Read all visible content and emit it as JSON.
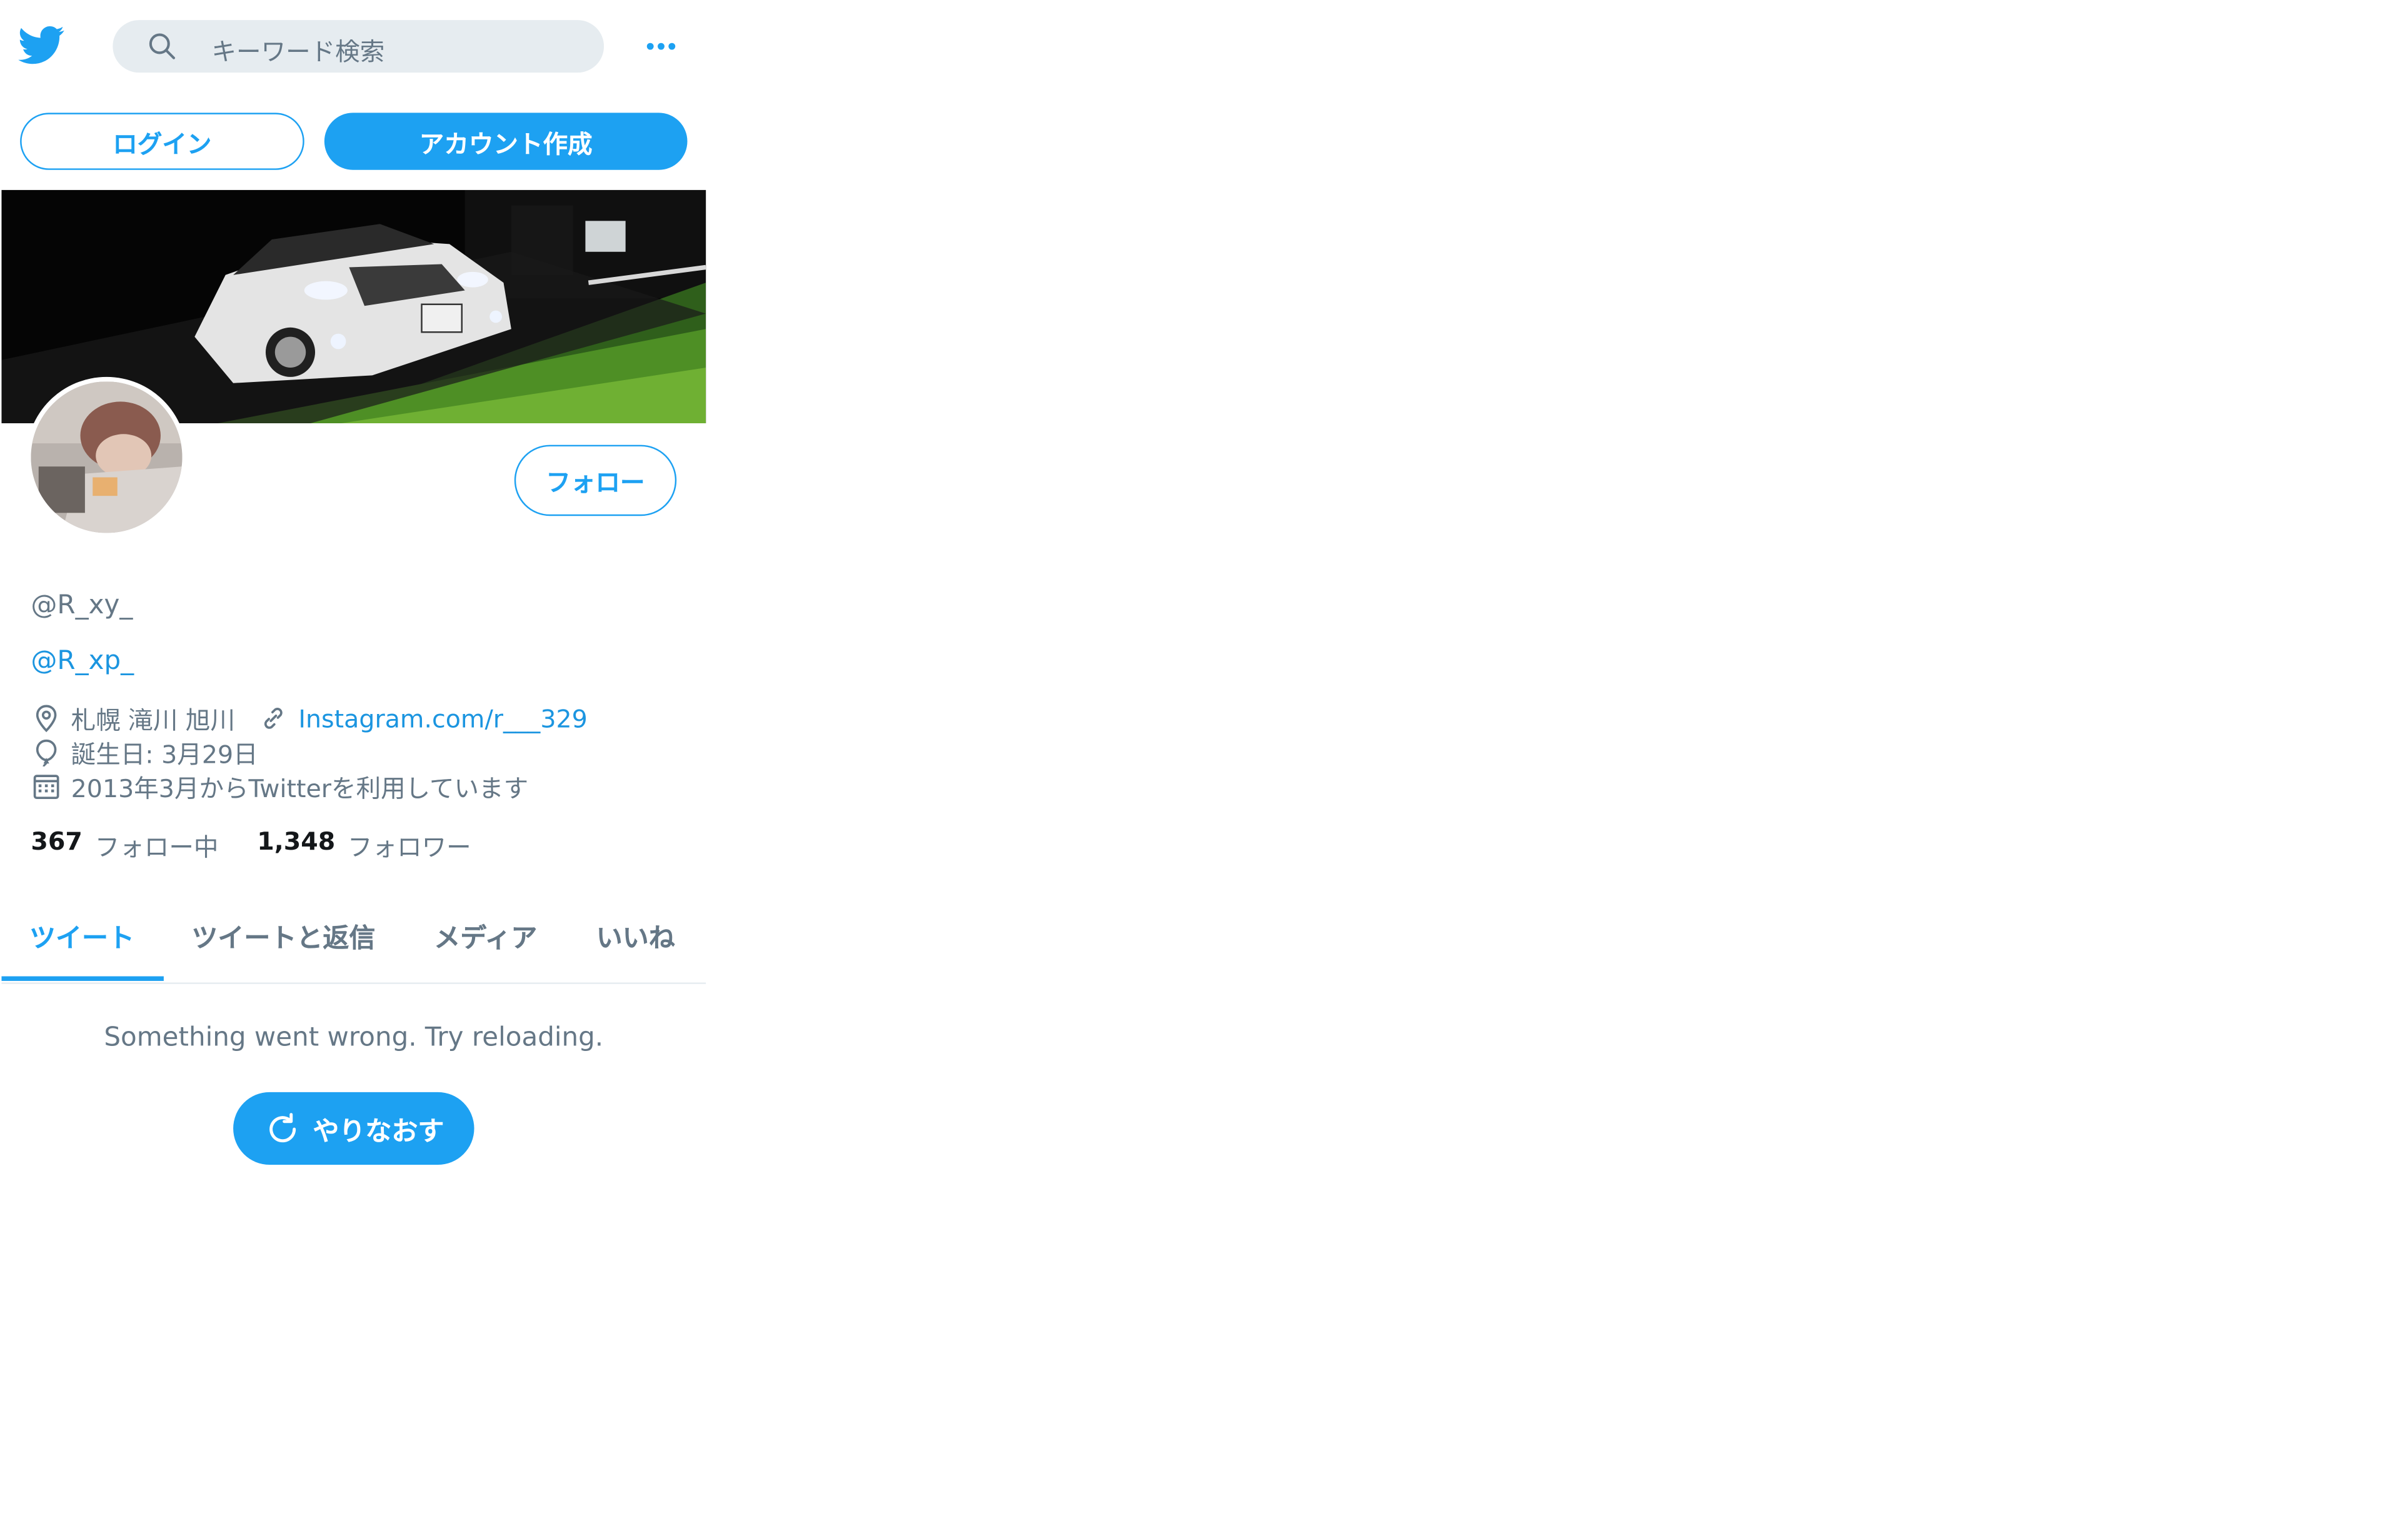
{
  "header": {
    "logo_icon": "twitter-bird-icon",
    "search_placeholder": "キーワード検索",
    "more_icon": "more-dots-icon"
  },
  "auth": {
    "login_label": "ログイン",
    "signup_label": "アカウント作成"
  },
  "profile": {
    "follow_label": "フォロー",
    "handle": "@R_xy_",
    "bio_mention": "@R_xp_",
    "location": "札幌 滝川 旭川",
    "url": "Instagram.com/r___329",
    "birthday": "誕生日: 3月29日",
    "joined": "2013年3月からTwitterを利用しています",
    "following_count": "367",
    "following_label": "フォロー中",
    "followers_count": "1,348",
    "followers_label": "フォロワー"
  },
  "tabs": [
    {
      "label": "ツイート",
      "active": true
    },
    {
      "label": "ツイートと返信",
      "active": false
    },
    {
      "label": "メディア",
      "active": false
    },
    {
      "label": "いいね",
      "active": false
    }
  ],
  "timeline": {
    "error_message": "Something went wrong. Try reloading.",
    "retry_label": "やりなおす"
  },
  "colors": {
    "accent": "#1da1f2",
    "link": "#1b95e0",
    "secondary_text": "#657786",
    "search_bg": "#e6ecf0"
  }
}
